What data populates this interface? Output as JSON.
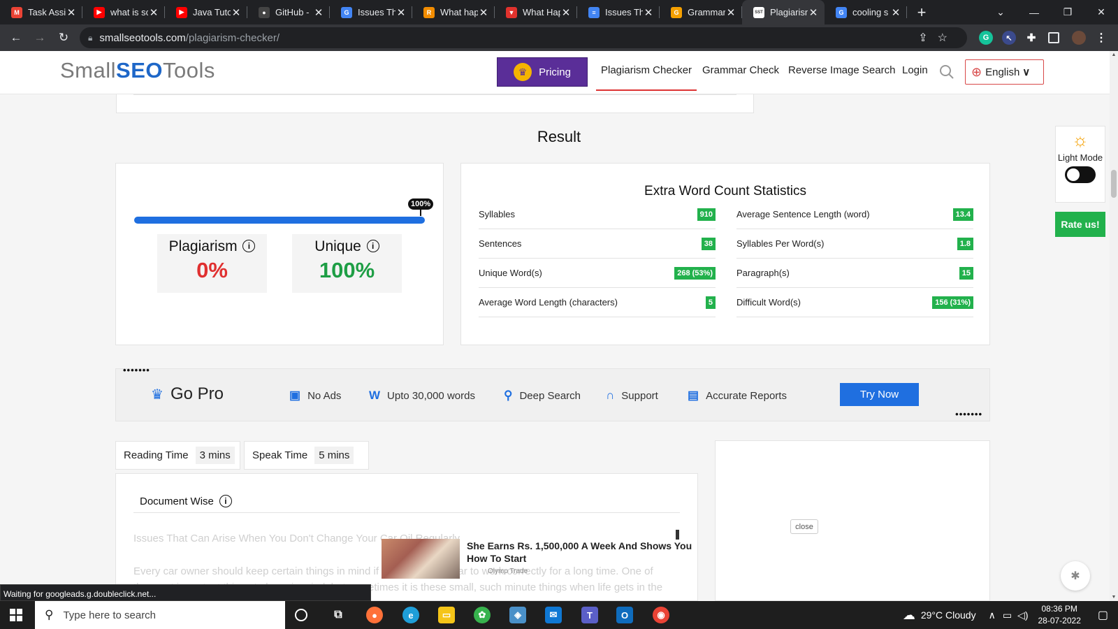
{
  "browser": {
    "tabs": [
      {
        "title": "Task Assig",
        "icon": "gmail-icon",
        "color": "#ea4335",
        "glyph": "M"
      },
      {
        "title": "what is sc",
        "icon": "youtube-icon",
        "color": "#ff0000",
        "glyph": "▶"
      },
      {
        "title": "Java Tuto",
        "icon": "youtube-icon",
        "color": "#ff0000",
        "glyph": "▶"
      },
      {
        "title": "GitHub - ",
        "icon": "github-icon",
        "color": "#444444",
        "glyph": "●"
      },
      {
        "title": "Issues Th",
        "icon": "google-icon",
        "color": "#4285f4",
        "glyph": "G"
      },
      {
        "title": "What hap",
        "icon": "site-icon",
        "color": "#f28c00",
        "glyph": "R"
      },
      {
        "title": "What Hap",
        "icon": "brave-icon",
        "color": "#e0322d",
        "glyph": "▼"
      },
      {
        "title": "Issues Th",
        "icon": "google-docs-icon",
        "color": "#4285f4",
        "glyph": "≡"
      },
      {
        "title": "Grammar",
        "icon": "grammar-icon",
        "color": "#f5a000",
        "glyph": "G"
      },
      {
        "title": "Plagiarism",
        "icon": "sst-icon",
        "color": "#ffffff",
        "glyph": "SST",
        "active": true
      },
      {
        "title": "cooling s",
        "icon": "google-icon",
        "color": "#4285f4",
        "glyph": "G"
      }
    ],
    "url_domain": "smallseotools.com",
    "url_path": "/plagiarism-checker/",
    "status_text": "Waiting for googleads.g.doubleclick.net..."
  },
  "site": {
    "logo_prefix": "Small",
    "logo_mark": "SEO",
    "logo_suffix": "Tools",
    "pricing_label": "Pricing",
    "nav": [
      "Plagiarism Checker",
      "Grammar Check",
      "Reverse Image Search",
      "Login"
    ],
    "language": "English"
  },
  "result": {
    "title": "Result",
    "progress_label": "100%",
    "progress_fraction": 1.0,
    "plagiarism_label": "Plagiarism",
    "plagiarism_value": "0%",
    "unique_label": "Unique",
    "unique_value": "100%"
  },
  "stats": {
    "title": "Extra Word Count Statistics",
    "left": [
      {
        "label": "Syllables",
        "value": "910"
      },
      {
        "label": "Sentences",
        "value": "38"
      },
      {
        "label": "Unique Word(s)",
        "value": "268 (53%)"
      },
      {
        "label": "Average Word Length (characters)",
        "value": "5"
      }
    ],
    "right": [
      {
        "label": "Average Sentence Length (word)",
        "value": "13.4"
      },
      {
        "label": "Syllables Per Word(s)",
        "value": "1.8"
      },
      {
        "label": "Paragraph(s)",
        "value": "15"
      },
      {
        "label": "Difficult Word(s)",
        "value": "156 (31%)"
      }
    ]
  },
  "gopro": {
    "title": "Go Pro",
    "features": [
      "No Ads",
      "Upto 30,000 words",
      "Deep Search",
      "Support",
      "Accurate Reports"
    ],
    "cta": "Try Now"
  },
  "times": {
    "reading_label": "Reading Time",
    "reading_value": "3 mins",
    "speak_label": "Speak Time",
    "speak_value": "5 mins"
  },
  "document": {
    "heading": "Document Wise",
    "line1": "Issues That Can Arise When You Don't Change Your Car Oil Regularly",
    "line2": "Every car owner should keep certain things in mind if they want their car to work correctly for a long time. One of",
    "line3": "the most important things to keep in mind, but sometimes it is these small, such minute things when life gets in the way. You're a full-time"
  },
  "ad": {
    "headline": "She Earns Rs. 1,500,000 A Week And Shows You How To Start",
    "source": "Olymp Trade",
    "close_label": "close"
  },
  "sidebar": {
    "mode_label": "Light Mode",
    "rate_label": "Rate us!"
  },
  "taskbar": {
    "search_placeholder": "Type here to search",
    "weather": "29°C  Cloudy",
    "time": "08:36 PM",
    "date": "28-07-2022"
  },
  "colors": {
    "accent_blue": "#1f6fe0",
    "plagiarism_red": "#e03030",
    "unique_green": "#1e9e45",
    "badge_green": "#22b14c",
    "pricing_purple": "#5a2e98"
  }
}
